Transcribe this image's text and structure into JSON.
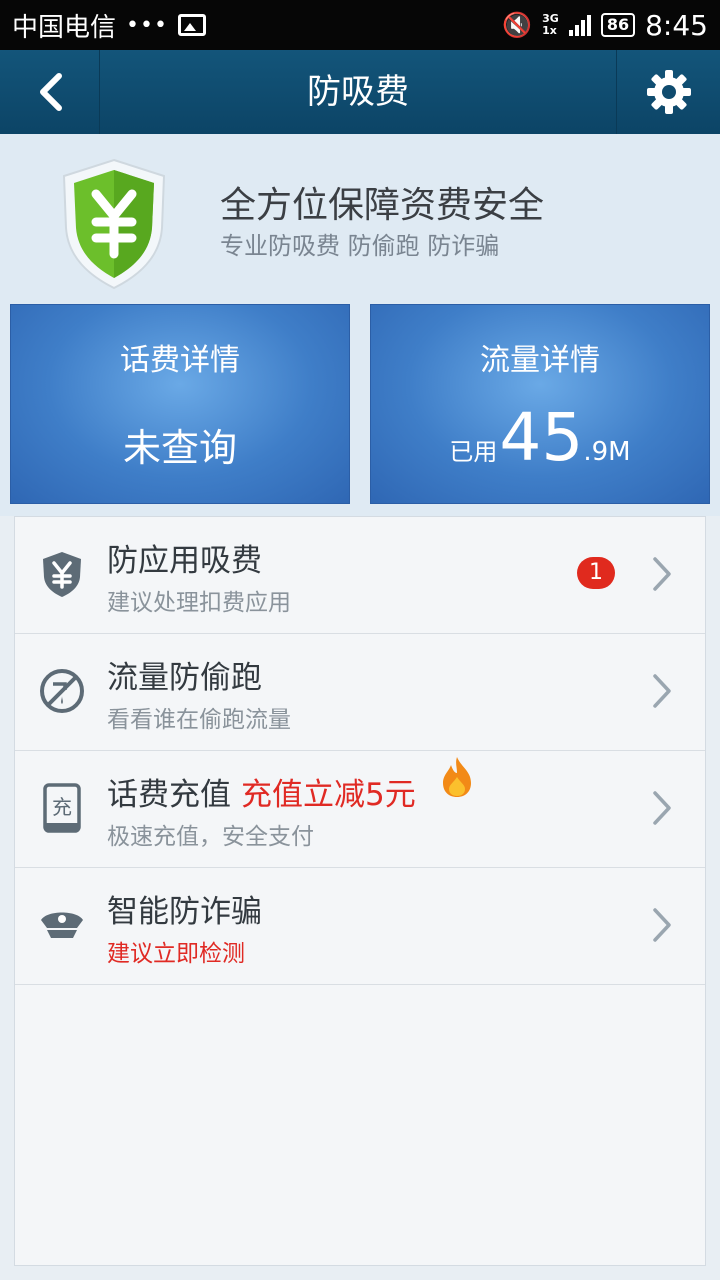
{
  "status_bar": {
    "carrier": "中国电信",
    "dots": "•••",
    "network_top": "3G",
    "network_bottom": "1x",
    "battery": "86",
    "time": "8:45"
  },
  "header": {
    "title": "防吸费"
  },
  "hero": {
    "title": "全方位保障资费安全",
    "subtitle": "专业防吸费 防偷跑 防诈骗"
  },
  "cards": {
    "phone_fee": {
      "title": "话费详情",
      "status": "未查询"
    },
    "data": {
      "title": "流量详情",
      "used_prefix": "已用",
      "used_int": "45",
      "used_dec": ".9M"
    }
  },
  "list": [
    {
      "title": "防应用吸费",
      "subtitle": "建议处理扣费应用",
      "badge": "1",
      "icon": "yen-shield-icon"
    },
    {
      "title": "流量防偷跑",
      "subtitle": "看看谁在偷跑流量",
      "icon": "no-leak-icon"
    },
    {
      "title": "话费充值",
      "promo": "充值立减5元",
      "subtitle": "极速充值，安全支付",
      "icon": "recharge-icon"
    },
    {
      "title": "智能防诈骗",
      "subtitle": "建议立即检测",
      "icon": "police-cap-icon"
    }
  ],
  "colors": {
    "header_bg": "#0c4466",
    "card_blue": "#3f7ec8",
    "alert_red": "#e02a24",
    "shield_green": "#6cbf2b"
  }
}
